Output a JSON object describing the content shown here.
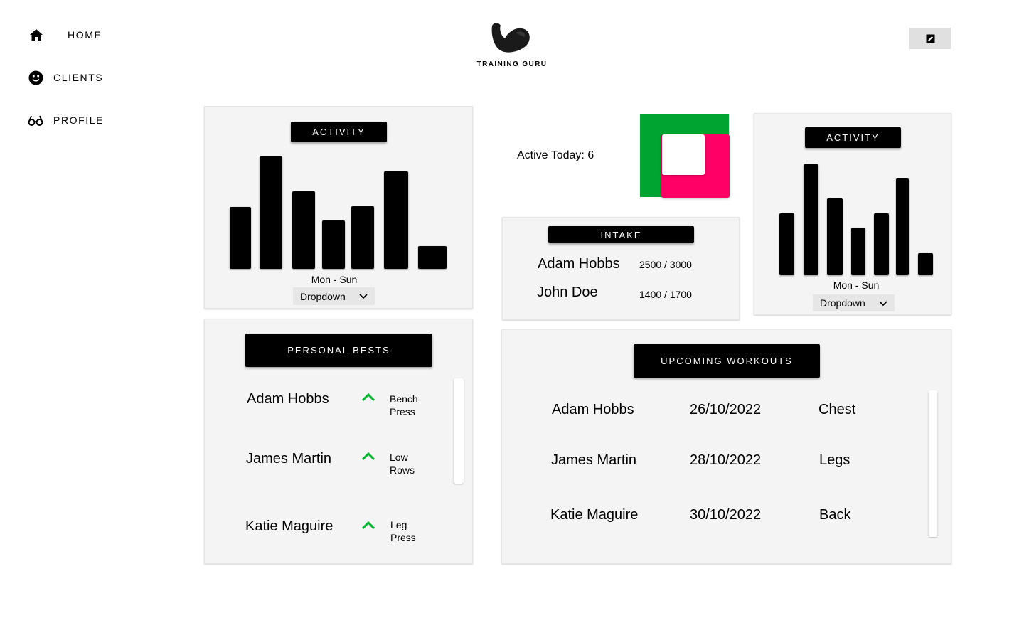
{
  "sidebar": {
    "items": [
      {
        "label": "HOME",
        "icon": "home-icon"
      },
      {
        "label": "CLIENTS",
        "icon": "smiley-icon"
      },
      {
        "label": "PROFILE",
        "icon": "glasses-icon"
      }
    ]
  },
  "logo": {
    "text": "TRAINING GURU"
  },
  "activity_left": {
    "title": "ACTIVITY",
    "week_label": "Mon - Sun",
    "dropdown": "Dropdown",
    "bars": [
      0.55,
      1.0,
      0.69,
      0.43,
      0.56,
      0.87,
      0.2
    ]
  },
  "active_today": {
    "label": "Active Today: 6",
    "colors": {
      "green": "#00a531",
      "pink": "#ff0066"
    }
  },
  "activity_right": {
    "title": "ACTIVITY",
    "week_label": "Mon - Sun",
    "dropdown": "Dropdown",
    "bars": [
      0.56,
      1.0,
      0.69,
      0.43,
      0.56,
      0.87,
      0.2
    ]
  },
  "intake": {
    "title": "INTAKE",
    "rows": [
      {
        "name": "Adam Hobbs",
        "value": "2500 / 3000"
      },
      {
        "name": "John Doe",
        "value": "1400 / 1700"
      }
    ]
  },
  "personal_bests": {
    "title": "PERSONAL BESTS",
    "rows": [
      {
        "name": "Adam Hobbs",
        "line1": "Bench",
        "line2": "Press"
      },
      {
        "name": "James Martin",
        "line1": "Low",
        "line2": "Rows"
      },
      {
        "name": "Katie Maguire",
        "line1": "Leg",
        "line2": "Press"
      }
    ]
  },
  "workouts": {
    "title": "UPCOMING WORKOUTS",
    "rows": [
      {
        "name": "Adam Hobbs",
        "date": "26/10/2022",
        "type": "Chest"
      },
      {
        "name": "James Martin",
        "date": "28/10/2022",
        "type": "Legs"
      },
      {
        "name": "Katie Maguire",
        "date": "30/10/2022",
        "type": "Back"
      }
    ]
  },
  "colors": {
    "accent_up": "#00b82e"
  }
}
